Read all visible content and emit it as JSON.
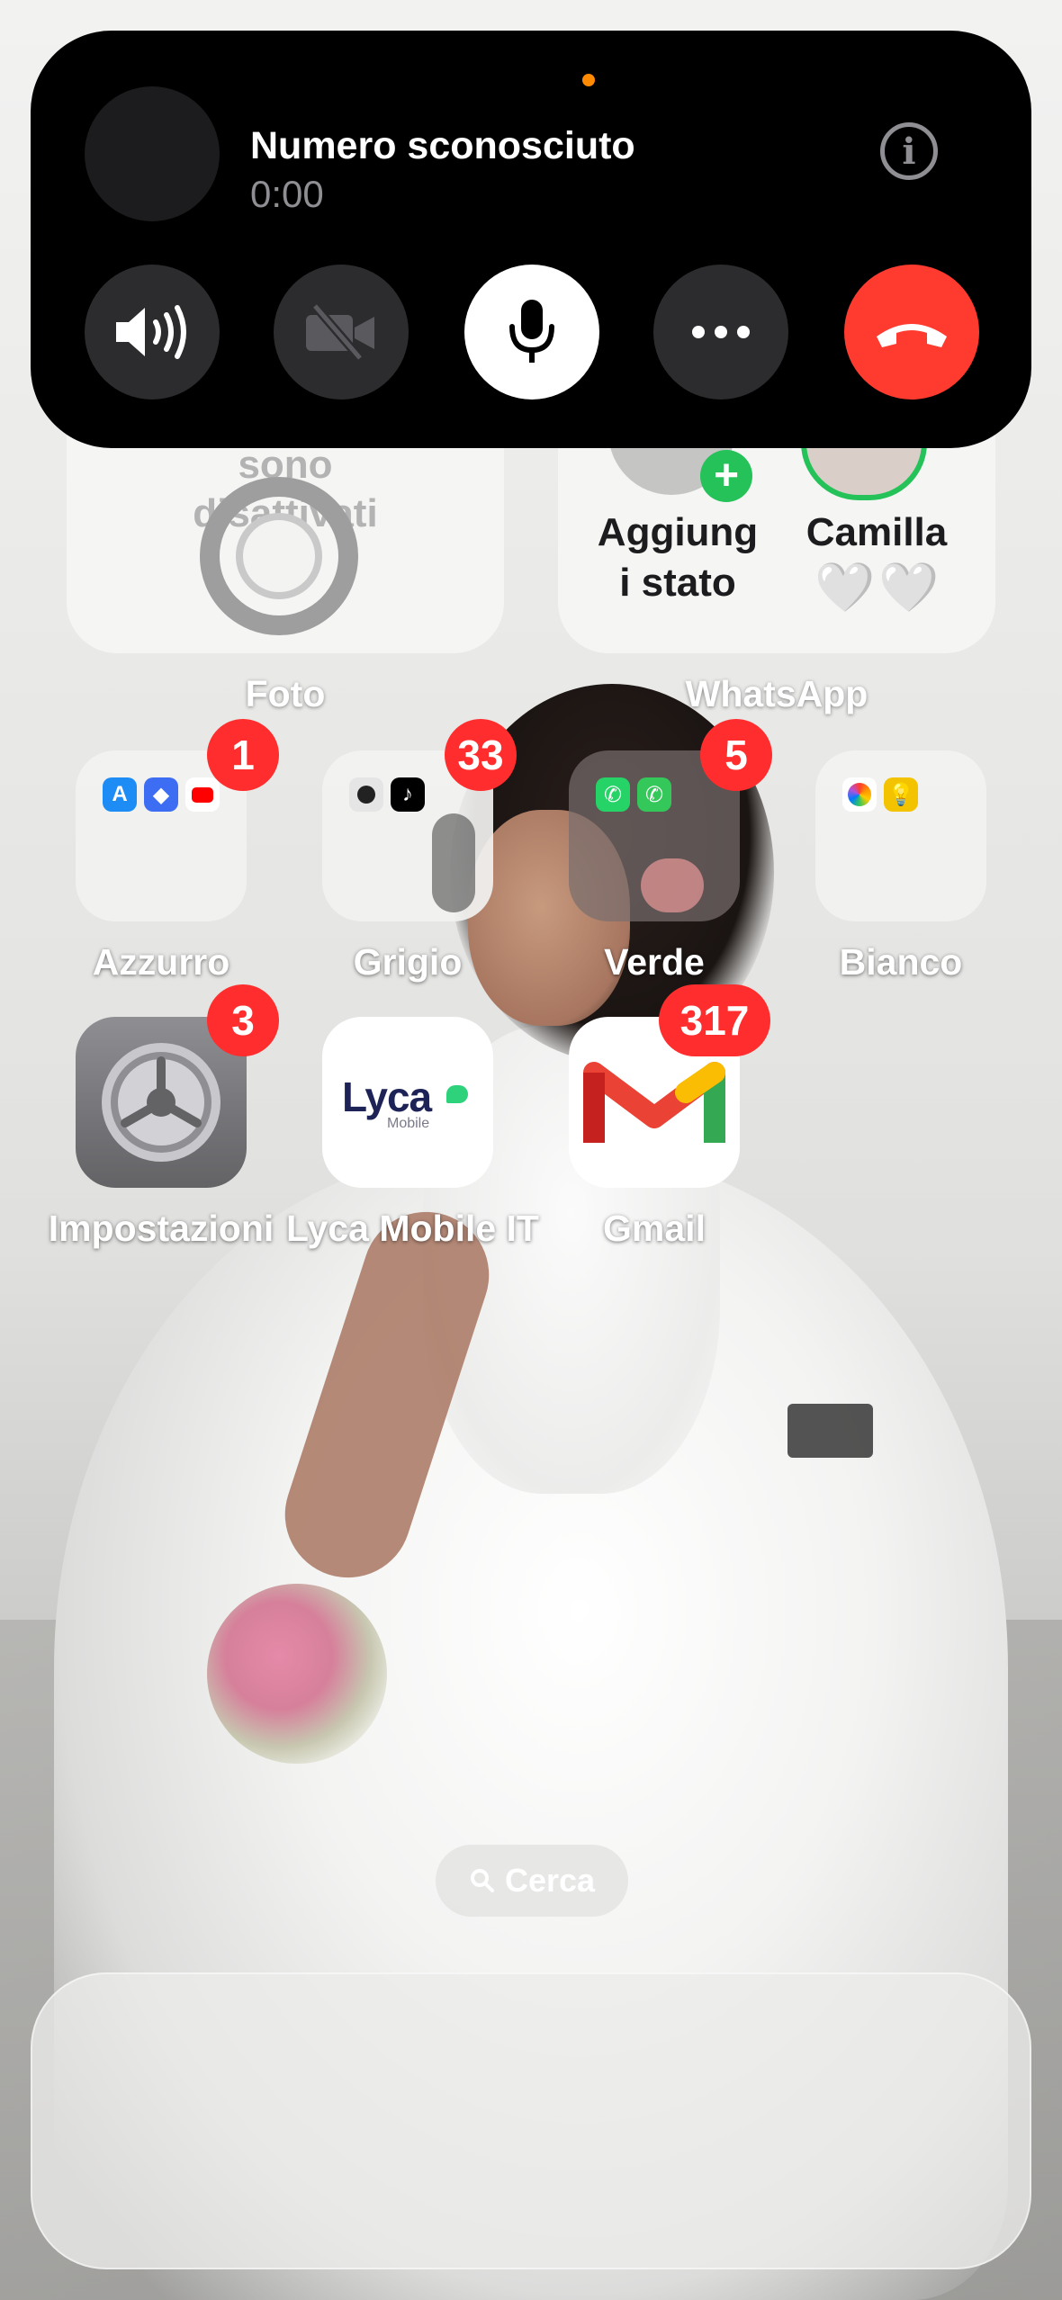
{
  "call": {
    "caller_name": "Numero sconosciuto",
    "duration": "0:00",
    "info_icon": "info-icon",
    "controls": [
      {
        "name": "speaker-button",
        "icon": "speaker-icon"
      },
      {
        "name": "video-button",
        "icon": "video-off-icon"
      },
      {
        "name": "mute-button",
        "icon": "microphone-icon"
      },
      {
        "name": "more-button",
        "icon": "ellipsis-icon"
      },
      {
        "name": "end-call-button",
        "icon": "end-call-icon"
      }
    ],
    "colors": {
      "banner": "#000000",
      "end_call": "#ff3b30",
      "indicator": "#ff8a00"
    }
  },
  "widgets": {
    "photos": {
      "text_line1": "sono",
      "text_line2": "disattivati",
      "title": "Foto"
    },
    "whatsapp": {
      "status_label_line1": "Aggiung",
      "status_label_line2": "i stato",
      "contact_name": "Camilla",
      "contact_status": "🤍🤍",
      "title": "WhatsApp"
    }
  },
  "apps": {
    "row1": [
      {
        "label": "Azzurro",
        "badge": "1"
      },
      {
        "label": "Grigio",
        "badge": "33"
      },
      {
        "label": "Verde",
        "badge": "5"
      },
      {
        "label": "Bianco",
        "badge": ""
      }
    ],
    "row2": [
      {
        "label": "Impostazioni",
        "badge": "3"
      },
      {
        "label": "Lyca Mobile IT",
        "badge": "",
        "logo_text": "Lyca",
        "logo_sub": "Mobile"
      },
      {
        "label": "Gmail",
        "badge": "317"
      }
    ]
  },
  "search": {
    "label": "Cerca"
  }
}
